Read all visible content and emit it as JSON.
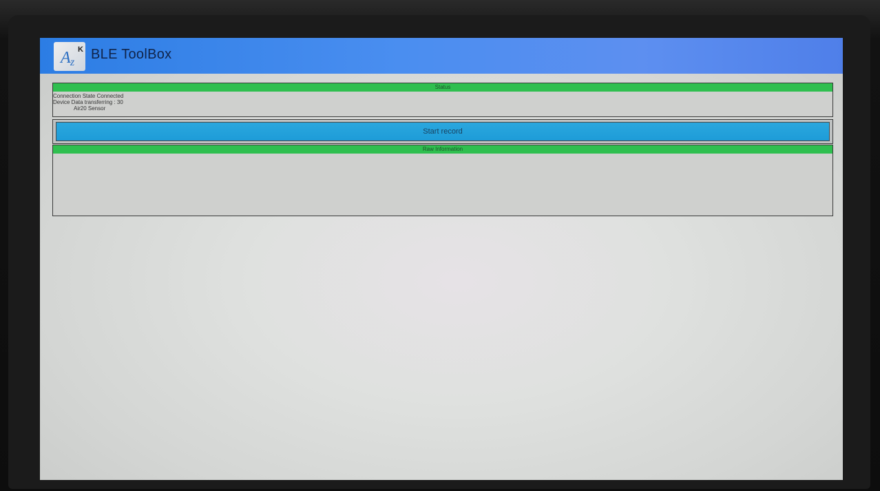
{
  "app": {
    "title": "BLE ToolBox"
  },
  "status_panel": {
    "header": "Status",
    "lines": [
      "Connection State Connected",
      "Device Data transferring : 30",
      "Air20 Sensor"
    ]
  },
  "record_button": {
    "label": "Start record"
  },
  "raw_panel": {
    "header": "Raw Information"
  },
  "colors": {
    "titlebar": "#4a8ef0",
    "status_header": "#2fbf4f",
    "record_button": "#1e9cd8"
  }
}
